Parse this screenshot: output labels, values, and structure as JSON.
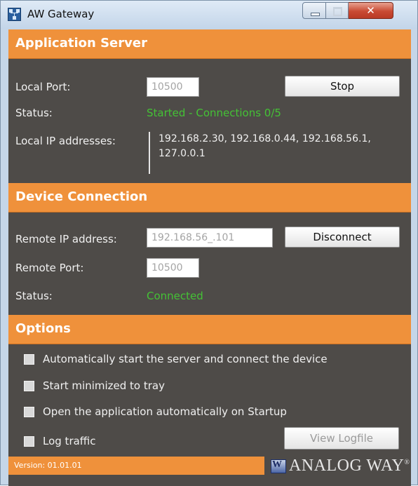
{
  "window": {
    "title": "AW Gateway",
    "close_glyph": "✕"
  },
  "application_server": {
    "header": "Application Server",
    "local_port_label": "Local Port:",
    "local_port_value": "10500",
    "stop_label": "Stop",
    "status_label": "Status:",
    "status_value": "Started - Connections 0/5",
    "ip_label": "Local IP addresses:",
    "ip_line1": "192.168.2.30, 192.168.0.44, 192.168.56.1,",
    "ip_line2": "127.0.0.1"
  },
  "device_connection": {
    "header": "Device Connection",
    "remote_ip_label": "Remote IP address:",
    "remote_ip_value": "192.168.56_.101",
    "disconnect_label": "Disconnect",
    "remote_port_label": "Remote Port:",
    "remote_port_value": "10500",
    "status_label": "Status:",
    "status_value": "Connected"
  },
  "options": {
    "header": "Options",
    "items": [
      {
        "label": "Automatically start the server and connect the device",
        "checked": false
      },
      {
        "label": "Start minimized to tray",
        "checked": false
      },
      {
        "label": "Open the application automatically on Startup",
        "checked": false
      },
      {
        "label": "Log traffic",
        "checked": false
      }
    ],
    "view_logfile_label": "View Logfile"
  },
  "footer": {
    "version": "Version: 01.01.01",
    "brand": "ANALOG WAY",
    "brand_mark": "®"
  },
  "colors": {
    "accent_orange": "#ef913b",
    "panel_bg": "#4e4b48",
    "status_green": "#44c235"
  },
  "icons": [
    "network-app-icon",
    "minimize-icon",
    "maximize-icon",
    "close-icon",
    "analog-way-logo"
  ]
}
